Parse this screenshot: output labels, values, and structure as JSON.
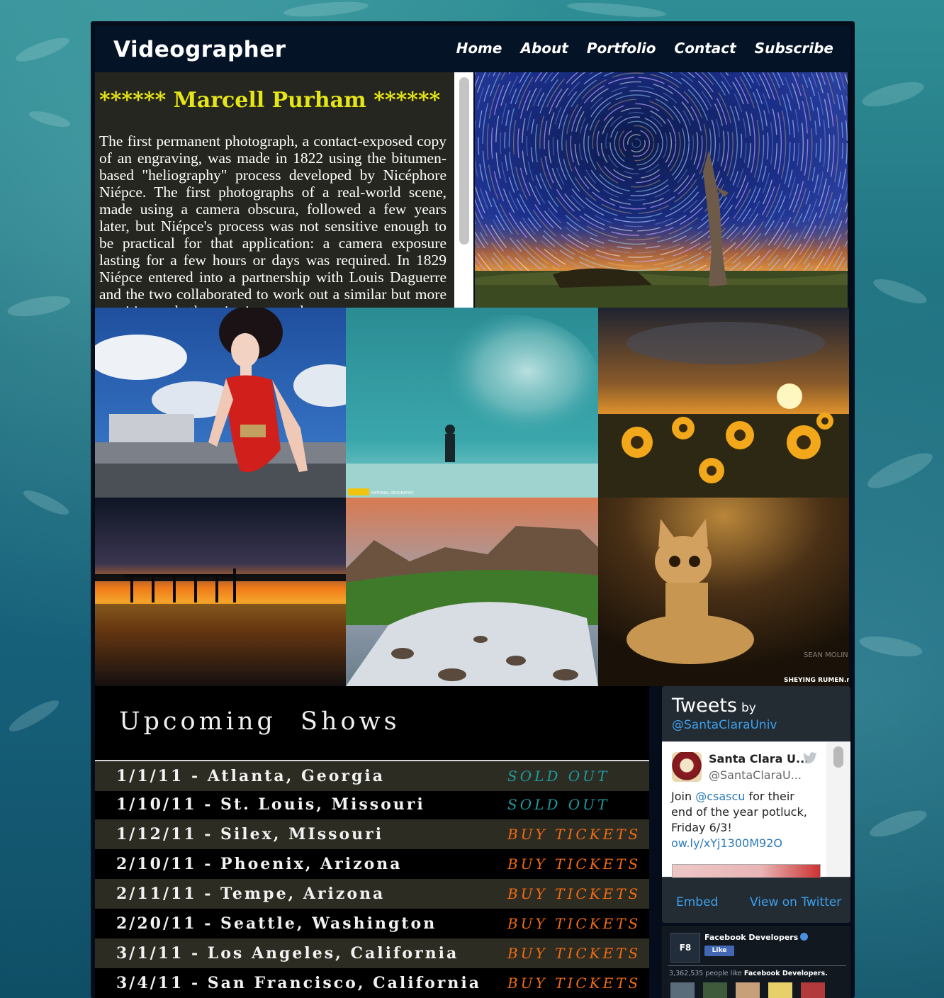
{
  "site": {
    "brand": "Videographer"
  },
  "nav": {
    "items": [
      "Home",
      "About",
      "Portfolio",
      "Contact",
      "Subscribe"
    ]
  },
  "bio": {
    "title": "****** Marcell Purham ******",
    "text": "The first permanent photograph, a contact-exposed copy of an engraving, was made in 1822 using the bitumen-based \"heliography\" process developed by Nicéphore Niépce. The first photographs of a real-world scene, made using a camera obscura, followed a few years later, but Niépce's process was not sensitive enough to be practical for that application: a camera exposure lasting for a few hours or days was required. In 1829 Niépce entered into a partnership with Louis Daguerre and the two collaborated to work out a similar but more sensitive and otherwise improved process."
  },
  "gallery": {
    "hero": "star-trails-photo",
    "tiles": [
      "fashion-model-photo",
      "diver-fish-school-photo",
      "sunflower-sunset-photo",
      "pier-sunset-photo",
      "mountain-river-photo",
      "kitten-photo"
    ],
    "tile_text": {
      "natgeo": "NATIONAL GEOGRAPHIC",
      "watermark1": "SEAN MOLIN PHOTO",
      "watermark2": "SHEYING RUMEN.net"
    }
  },
  "shows": {
    "title": "Upcoming Shows",
    "rows": [
      {
        "date": "1/1/11 - Atlanta, Georgia",
        "status": "SOLD OUT",
        "sold_out": true
      },
      {
        "date": "1/10/11 - St. Louis, Missouri",
        "status": "SOLD OUT",
        "sold_out": true
      },
      {
        "date": "1/12/11 - Silex, MIssouri",
        "status": "BUY TICKETS",
        "sold_out": false
      },
      {
        "date": "2/10/11 - Phoenix, Arizona",
        "status": "BUY TICKETS",
        "sold_out": false
      },
      {
        "date": "2/11/11 - Tempe, Arizona",
        "status": "BUY TICKETS",
        "sold_out": false
      },
      {
        "date": "2/20/11 - Seattle, Washington",
        "status": "BUY TICKETS",
        "sold_out": false
      },
      {
        "date": "3/1/11 - Los Angeles, California",
        "status": "BUY TICKETS",
        "sold_out": false
      },
      {
        "date": "3/4/11 - San Francisco, California",
        "status": "BUY TICKETS",
        "sold_out": false
      }
    ],
    "colors": {
      "sold_out": "#1f9ba0",
      "buy": "#f26b13"
    }
  },
  "twitter": {
    "title": "Tweets",
    "by": "by",
    "handle": "@SantaClaraUniv",
    "tweet": {
      "name": "Santa Clara U...",
      "user": "@SantaClaraU...",
      "text_before": "Join ",
      "mention": "@csascu",
      "text_after": " for their end of the year potluck, Friday 6/3!",
      "link": "ow.ly/xYj1300M92O"
    },
    "embed": "Embed",
    "view": "View on Twitter"
  },
  "facebook": {
    "logo": "F8",
    "page": "Facebook Developers",
    "like": "Like",
    "count_num": "3,362,535",
    "count_text": " people like ",
    "count_page": "Facebook Developers."
  }
}
